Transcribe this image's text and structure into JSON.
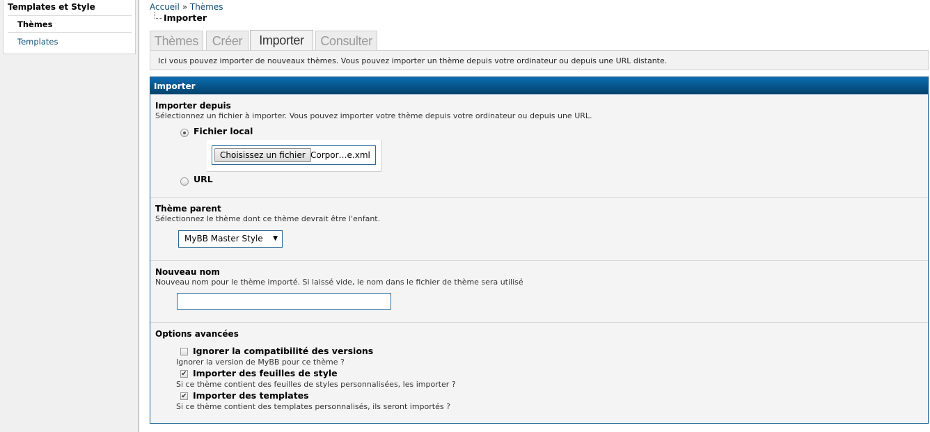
{
  "sidebar": {
    "title": "Templates et Style",
    "items": [
      {
        "label": "Thèmes"
      },
      {
        "label": "Templates"
      }
    ]
  },
  "breadcrumb": {
    "home": "Accueil",
    "separator": "»",
    "section": "Thèmes",
    "current": "Importer"
  },
  "tabs": [
    {
      "label": "Thèmes"
    },
    {
      "label": "Créer"
    },
    {
      "label": "Importer"
    },
    {
      "label": "Consulter"
    }
  ],
  "intro": "Ici vous pouvez importer de nouveaux thèmes. Vous pouvez importer un thème depuis votre ordinateur ou depuis une URL distante.",
  "form": {
    "header": "Importer",
    "import_from": {
      "title": "Importer depuis",
      "description": "Sélectionnez un fichier à importer. Vous pouvez importer votre thème depuis votre ordinateur ou depuis une URL.",
      "local_label": "Fichier local",
      "url_label": "URL",
      "selected": "Fichier local",
      "file_button": "Choisissez un fichier",
      "file_name": "Corpor…e.xml"
    },
    "parent_theme": {
      "title": "Thème parent",
      "description": "Sélectionnez le thème dont ce thème devrait être l'enfant.",
      "selected": "MyBB Master Style"
    },
    "new_name": {
      "title": "Nouveau nom",
      "description": "Nouveau nom pour le thème importé. Si laissé vide, le nom dans le fichier de thème sera utilisé",
      "value": ""
    },
    "advanced": {
      "title": "Options avancées",
      "options": [
        {
          "label": "Ignorer la compatibilité des versions",
          "description": "Ignorer la version de MyBB pour ce thème ?",
          "checked": false
        },
        {
          "label": "Importer des feuilles de style",
          "description": "Si ce thème contient des feuilles de styles personnalisées, les importer ?",
          "checked": true
        },
        {
          "label": "Importer des templates",
          "description": "Si ce thème contient des templates personnalisés, ils seront importés ?",
          "checked": true
        }
      ]
    }
  },
  "colors": {
    "header_gradient_top": "#0c6cb0",
    "header_gradient_bottom": "#02426b",
    "link": "#0f4c75",
    "border_blue": "#2c6a96"
  }
}
